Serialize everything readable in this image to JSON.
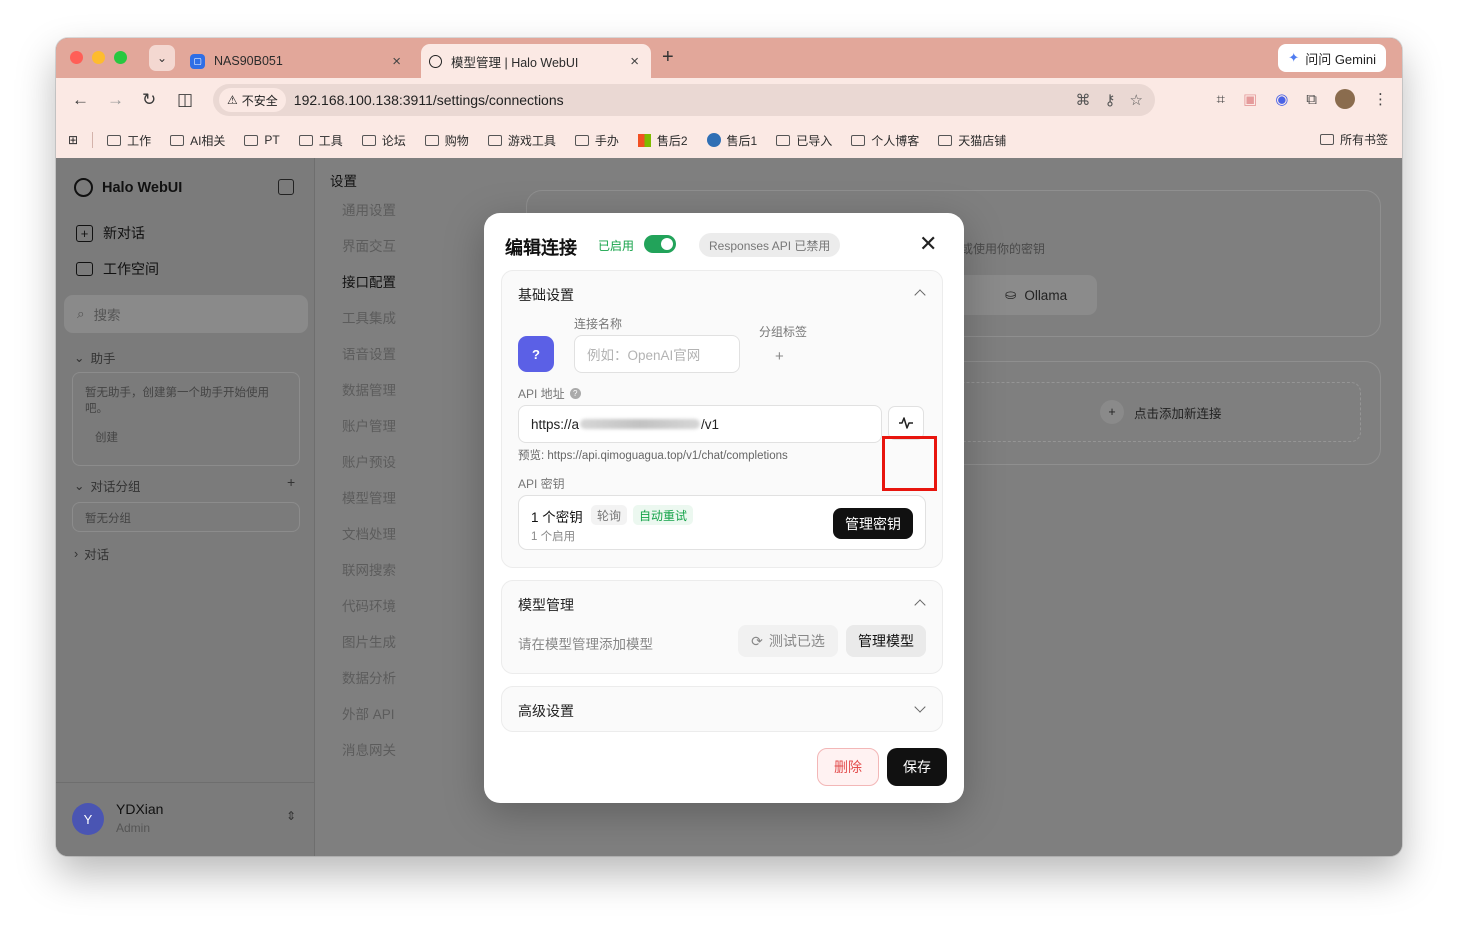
{
  "browser": {
    "tabs": [
      {
        "title": "NAS90B051"
      },
      {
        "title": "模型管理 | Halo WebUI"
      }
    ],
    "gemini_label": "问问 Gemini",
    "insecure_label": "不安全",
    "url": "192.168.100.138:3911/settings/connections",
    "bookmarks": [
      "工作",
      "AI相关",
      "PT",
      "工具",
      "论坛",
      "购物",
      "游戏工具",
      "手办",
      "售后2",
      "售后1",
      "已导入",
      "个人博客",
      "天猫店铺"
    ],
    "all_bookmarks": "所有书签"
  },
  "sidebar": {
    "app_name": "Halo WebUI",
    "new_chat": "新对话",
    "workspace": "工作空间",
    "search_placeholder": "搜索",
    "assistants_label": "助手",
    "assistants_empty": "暂无助手，创建第一个助手开始使用吧。",
    "create_label": "创建",
    "groups_label": "对话分组",
    "groups_empty": "暂无分组",
    "chats_label": "对话",
    "user_name": "YDXian",
    "user_role": "Admin",
    "avatar_initial": "Y"
  },
  "settings_nav": {
    "title": "设置",
    "items": [
      "通用设置",
      "界面交互",
      "接口配置",
      "工具集成",
      "语音设置",
      "数据管理",
      "账户管理",
      "账户预设",
      "模型管理",
      "文档处理",
      "联网搜索",
      "代码环境",
      "图片生成",
      "数据分析",
      "外部 API",
      "消息网关"
    ]
  },
  "background": {
    "hint": "或使用你的密钥",
    "ollama": "Ollama",
    "add_connection": "点击添加新连接"
  },
  "modal": {
    "title": "编辑连接",
    "enabled_label": "已启用",
    "responses_badge": "Responses API 已禁用",
    "basic": {
      "title": "基础设置",
      "avatar_char": "?",
      "name_label": "连接名称",
      "name_placeholder": "例如：OpenAI官网",
      "tag_label": "分组标签",
      "tag_add": "+",
      "api_label": "API 地址",
      "api_prefix": "https://a",
      "api_suffix": "/v1",
      "preview": "预览: https://api.qimoguagua.top/v1/chat/completions",
      "key_label": "API 密钥",
      "key_count": "1 个密钥",
      "key_mode": "轮询",
      "key_retry": "自动重试",
      "key_enabled": "1 个启用",
      "manage_keys": "管理密钥"
    },
    "models": {
      "title": "模型管理",
      "empty": "请在模型管理添加模型",
      "test_selected": "测试已选",
      "manage_models": "管理模型"
    },
    "advanced": {
      "title": "高级设置"
    },
    "delete_label": "删除",
    "save_label": "保存"
  },
  "colors": {
    "enabled_green": "#16a34a",
    "avatar_purple": "#5b60e6",
    "highlight_red": "#e8150e",
    "delete_red": "#e34c4c"
  }
}
